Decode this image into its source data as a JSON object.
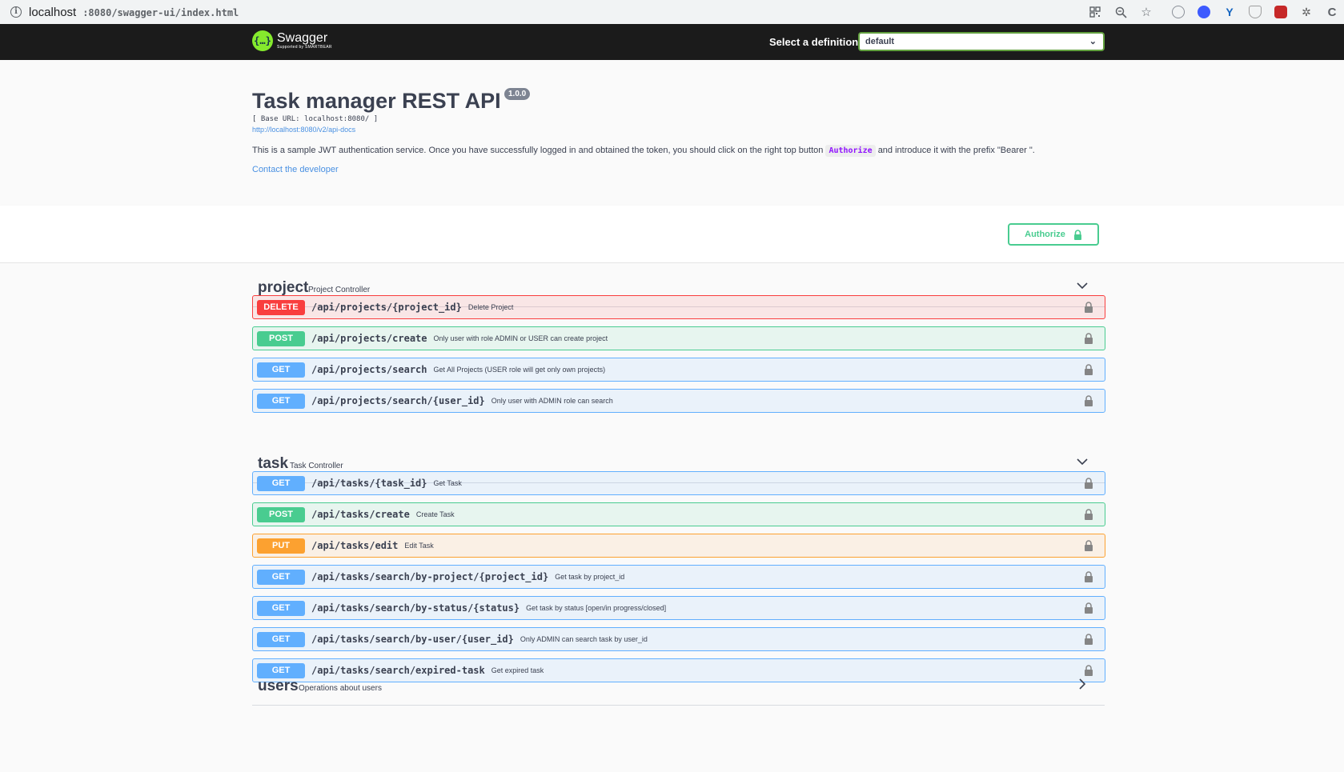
{
  "browser": {
    "url_host": "localhost",
    "url_rest": ":8080/swagger-ui/index.html",
    "toolbar_icons": [
      "qr-code-icon",
      "zoom-icon",
      "bookmark-star-icon"
    ],
    "extensions": [
      {
        "name": "extension-1-icon",
        "color": "#8a8f98"
      },
      {
        "name": "extension-2-icon",
        "color": "#3d5afe"
      },
      {
        "name": "extension-3-icon",
        "color": "#1565c0"
      },
      {
        "name": "extension-4-icon",
        "color": "#9e9e9e"
      },
      {
        "name": "extension-5-icon",
        "color": "#c62828"
      },
      {
        "name": "extension-6-icon",
        "color": "#616161"
      },
      {
        "name": "extension-7-icon",
        "color": "#5f6368"
      }
    ]
  },
  "topbar": {
    "logo_title": "Swagger",
    "logo_subtitle": "Supported by SMARTBEAR",
    "definition_label": "Select a definition",
    "definition_value": "default"
  },
  "info": {
    "title": "Task manager REST API",
    "version": "1.0.0",
    "base_url": "[ Base URL: localhost:8080/ ]",
    "api_docs_link": "http://localhost:8080/v2/api-docs",
    "description_before": "This is a sample JWT authentication service. Once you have successfully logged in and obtained the token, you should click on the right top button",
    "description_code": "Authorize",
    "description_after": "and introduce it with the prefix \"Bearer \".",
    "contact_link": "Contact the developer"
  },
  "authorize_button": "Authorize",
  "colors": {
    "delete": "#f93e3e",
    "post": "#49cc90",
    "get": "#61affe",
    "put": "#fca130"
  },
  "tags": [
    {
      "name": "project",
      "description": "Project Controller",
      "expanded": true,
      "operations": [
        {
          "method": "DELETE",
          "path": "/api/projects/{project_id}",
          "summary": "Delete Project"
        },
        {
          "method": "POST",
          "path": "/api/projects/create",
          "summary": "Only user with role ADMIN or USER can create project"
        },
        {
          "method": "GET",
          "path": "/api/projects/search",
          "summary": "Get All Projects (USER role will get only own projects)"
        },
        {
          "method": "GET",
          "path": "/api/projects/search/{user_id}",
          "summary": "Only user with ADMIN role can search"
        }
      ]
    },
    {
      "name": "task",
      "description": "Task Controller",
      "expanded": true,
      "operations": [
        {
          "method": "GET",
          "path": "/api/tasks/{task_id}",
          "summary": "Get Task"
        },
        {
          "method": "POST",
          "path": "/api/tasks/create",
          "summary": "Create Task"
        },
        {
          "method": "PUT",
          "path": "/api/tasks/edit",
          "summary": "Edit Task"
        },
        {
          "method": "GET",
          "path": "/api/tasks/search/by-project/{project_id}",
          "summary": "Get task by project_id"
        },
        {
          "method": "GET",
          "path": "/api/tasks/search/by-status/{status}",
          "summary": "Get task by status [open/in progress/closed]"
        },
        {
          "method": "GET",
          "path": "/api/tasks/search/by-user/{user_id}",
          "summary": "Only ADMIN can search task by user_id"
        },
        {
          "method": "GET",
          "path": "/api/tasks/search/expired-task",
          "summary": "Get expired task"
        }
      ]
    },
    {
      "name": "users",
      "description": "Operations about users",
      "expanded": false,
      "operations": []
    }
  ]
}
